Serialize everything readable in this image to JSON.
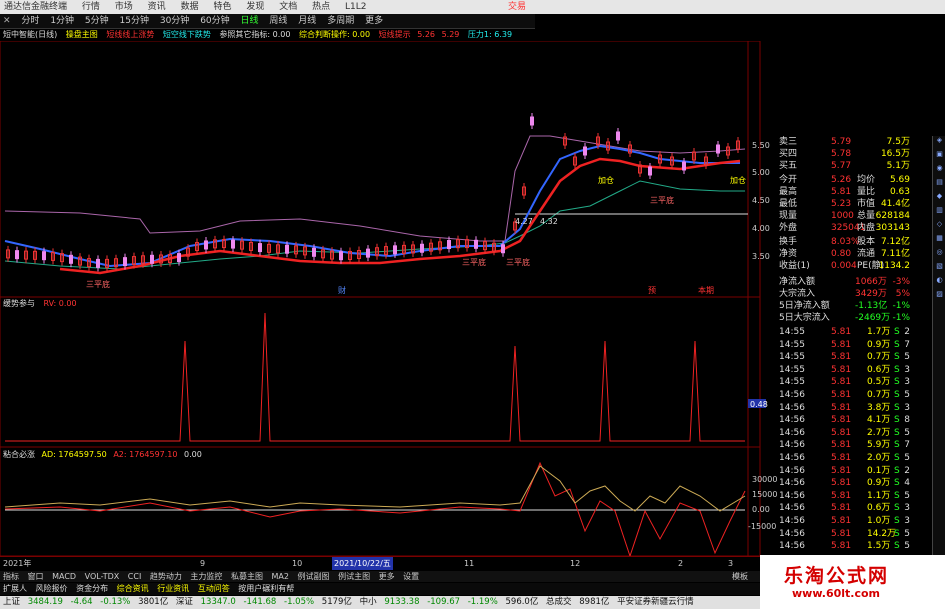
{
  "app": {
    "title": "通达信金融终端",
    "menu": [
      "行情",
      "市场",
      "资讯",
      "数据",
      "特色",
      "发现",
      "文档",
      "热点",
      "L1L2"
    ],
    "right_menu": "交易"
  },
  "toolbar": {
    "items": [
      "分时",
      "1分钟",
      "5分钟",
      "15分钟",
      "30分钟",
      "60分钟",
      "日线",
      "周线",
      "月线",
      "多周期",
      "更多"
    ],
    "active": "日线"
  },
  "main_indicator": {
    "name": "短中智能(日线)",
    "subname": "操盘主图",
    "labels": [
      "短线线上涨势",
      "短空线下跌势",
      "参照其它指标: 0.00",
      "综合判断操作: 0.00",
      "短线提示",
      "5.26",
      "5.29",
      "压力1: 6.39"
    ],
    "price_axis": [
      "5.50",
      "5.00",
      "4.50",
      "4.00",
      "3.50"
    ],
    "annotations": [
      "4.27",
      "4.32",
      "三平底",
      "三平底",
      "三平底",
      "三平底",
      "加仓",
      "加仓"
    ],
    "markers": [
      "财",
      "预",
      "本期"
    ]
  },
  "sub1": {
    "name": "缓势参与",
    "value": "RV: 0.00",
    "axis_value": "0.48"
  },
  "sub2": {
    "name": "粘合必涨",
    "ad_label": "AD: 1764597.50",
    "a2_label": "A2: 1764597.10",
    "value": "0.00",
    "axis": [
      "30000",
      "15000",
      "0.00",
      "-15000"
    ]
  },
  "datebar": {
    "labels": [
      "2021年",
      "9",
      "10",
      "2021/10/22/五",
      "11",
      "12",
      "2",
      "3"
    ]
  },
  "tabs": {
    "items": [
      "指标",
      "窗口",
      "MACD",
      "VOL-TDX",
      "CCI",
      "趋势动力",
      "主力监控",
      "私募主图",
      "MA2",
      "例试副图",
      "例试主图",
      "更多",
      "设置"
    ],
    "right": "模板"
  },
  "tabs2": {
    "items": [
      "扩展人",
      "风险报价",
      "资金分布",
      "综合资讯",
      "行业资讯",
      "互动问答",
      "按用户碾利有帮"
    ]
  },
  "quote_panel": {
    "rows": [
      {
        "label": "卖三",
        "price": "5.79",
        "vol": "7.5万"
      },
      {
        "label": "买四",
        "price": "5.78",
        "vol": "16.5万"
      },
      {
        "label": "买五",
        "price": "5.77",
        "vol": "5.1万"
      },
      {
        "label": "今开",
        "price": "5.26",
        "k2": "均价",
        "v2": "5.69"
      },
      {
        "label": "最高",
        "price": "5.81",
        "k2": "量比",
        "v2": "0.63"
      },
      {
        "label": "最低",
        "price": "5.23",
        "k2": "市值",
        "v2": "41.4亿"
      },
      {
        "label": "现量",
        "price": "1000",
        "k2": "总量",
        "v2": "628184"
      },
      {
        "label": "外盘",
        "price": "325041",
        "k2": "内盘",
        "v2": "303143"
      },
      {
        "label": "换手",
        "price": "8.03%",
        "k2": "股本",
        "v2": "7.12亿"
      },
      {
        "label": "净资",
        "price": "0.80",
        "k2": "流通",
        "v2": "7.11亿"
      },
      {
        "label": "收益(1)",
        "price": "0.004",
        "k2": "PE(静)",
        "v2": "1134.2"
      }
    ],
    "flow": [
      {
        "label": "净流入额",
        "value": "1066万",
        "pct": "-3%"
      },
      {
        "label": "大宗流入",
        "value": "3429万",
        "pct": "5%"
      },
      {
        "label": "5日净流入额",
        "value": "-1.13亿",
        "pct": "-1%"
      },
      {
        "label": "5日大宗流入",
        "value": "-2469万",
        "pct": "-1%"
      }
    ],
    "ticks": [
      {
        "time": "14:55",
        "price": "5.81",
        "vol": "1.7万",
        "side": "S",
        "n": "2"
      },
      {
        "time": "14:55",
        "price": "5.81",
        "vol": "0.9万",
        "side": "S",
        "n": "7"
      },
      {
        "time": "14:55",
        "price": "5.81",
        "vol": "0.7万",
        "side": "S",
        "n": "5"
      },
      {
        "time": "14:55",
        "price": "5.81",
        "vol": "0.6万",
        "side": "S",
        "n": "3"
      },
      {
        "time": "14:55",
        "price": "5.81",
        "vol": "0.5万",
        "side": "S",
        "n": "3"
      },
      {
        "time": "14:56",
        "price": "5.81",
        "vol": "0.7万",
        "side": "S",
        "n": "5"
      },
      {
        "time": "14:56",
        "price": "5.81",
        "vol": "3.8万",
        "side": "S",
        "n": "3"
      },
      {
        "time": "14:56",
        "price": "5.81",
        "vol": "4.1万",
        "side": "S",
        "n": "8"
      },
      {
        "time": "14:56",
        "price": "5.81",
        "vol": "2.7万",
        "side": "S",
        "n": "5"
      },
      {
        "time": "14:56",
        "price": "5.81",
        "vol": "5.9万",
        "side": "S",
        "n": "7"
      },
      {
        "time": "14:56",
        "price": "5.81",
        "vol": "2.0万",
        "side": "S",
        "n": "5"
      },
      {
        "time": "14:56",
        "price": "5.81",
        "vol": "0.1万",
        "side": "S",
        "n": "2"
      },
      {
        "time": "14:56",
        "price": "5.81",
        "vol": "0.9万",
        "side": "S",
        "n": "4"
      },
      {
        "time": "14:56",
        "price": "5.81",
        "vol": "1.1万",
        "side": "S",
        "n": "5"
      },
      {
        "time": "14:56",
        "price": "5.81",
        "vol": "0.6万",
        "side": "S",
        "n": "3"
      },
      {
        "time": "14:56",
        "price": "5.81",
        "vol": "1.0万",
        "side": "S",
        "n": "3"
      },
      {
        "time": "14:56",
        "price": "5.81",
        "vol": "14.2万",
        "side": "S",
        "n": "5"
      },
      {
        "time": "14:56",
        "price": "5.81",
        "vol": "1.5万",
        "side": "S",
        "n": "5"
      }
    ]
  },
  "statusbar": {
    "items": [
      "上证",
      "3484.19",
      "-4.64",
      "-0.13%",
      "3801亿",
      "深证",
      "13347.0",
      "-141.68",
      "-1.05%",
      "5179亿",
      "中小",
      "9133.38",
      "-109.67",
      "-1.19%",
      "596.0亿",
      "总成交",
      "8981亿",
      "平安证券新疆云行情"
    ]
  },
  "brand": {
    "name": "乐淘公式网",
    "url": "www.60lt.com"
  },
  "colors": {
    "up": "#ff3333",
    "down": "#22ff22",
    "border": "#7a0000",
    "accent": "#ffff00"
  }
}
